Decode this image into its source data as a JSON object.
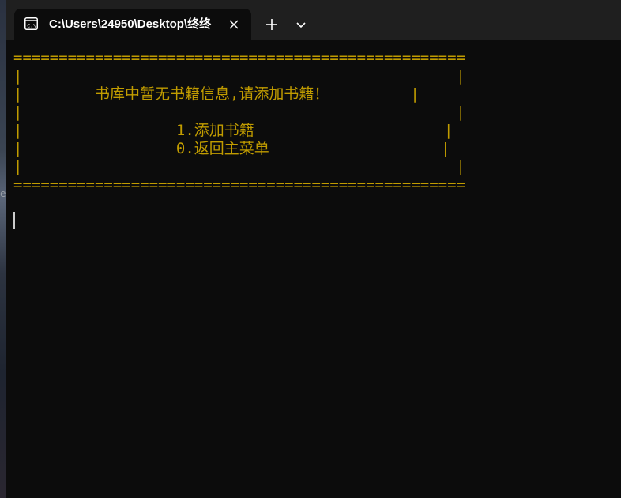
{
  "tab": {
    "title": "C:\\Users\\24950\\Desktop\\终终"
  },
  "console": {
    "lines": [
      "==================================================",
      "|                                                |",
      "|        书库中暂无书籍信息,请添加书籍！         |",
      "|                                                |",
      "|                 1.添加书籍                     |",
      "|                 0.返回主菜单                   |",
      "|                                                |",
      "=================================================="
    ]
  },
  "colors": {
    "console_text": "#c19c00",
    "console_background": "#0c0c0c",
    "tabbar_background": "#1f1f1f"
  },
  "icons": {
    "tab_icon": "terminal-icon",
    "close": "close-icon",
    "new_tab": "plus-icon",
    "dropdown": "chevron-down-icon"
  },
  "desktop": {
    "edge_glyph": "e"
  }
}
